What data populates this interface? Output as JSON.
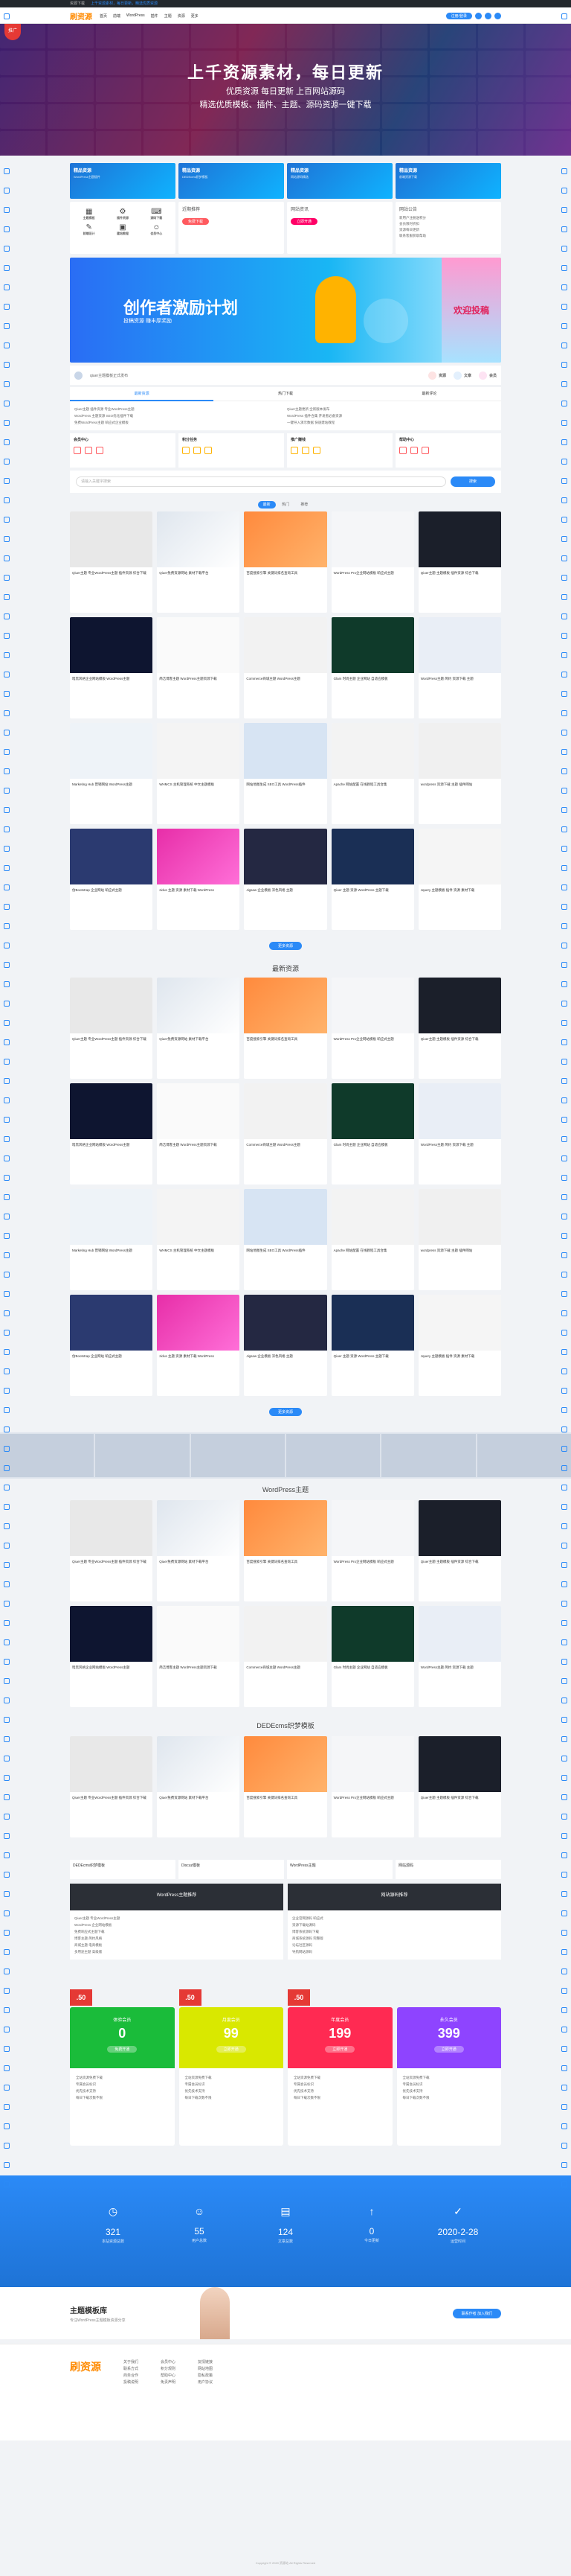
{
  "topbar": {
    "brand": "资源下载",
    "notice": "上千资源素材，每日更新，精选优质资源"
  },
  "header": {
    "logo": "刷资源",
    "nav": [
      "首页",
      "前端",
      "WordPress",
      "插件",
      "主题",
      "资源",
      "更多"
    ],
    "register": "注册/登录"
  },
  "hero": {
    "badge": "推广",
    "title": "上千资源素材，每日更新",
    "line2": "优质资源  每日更新  上百网站源码",
    "line3": "精选优质模板、插件、主题、源码资源一键下载"
  },
  "cards": [
    {
      "title": "精品资源",
      "sub": "WordPress主题插件"
    },
    {
      "title": "精品资源",
      "sub": "DEDEcms织梦模板"
    },
    {
      "title": "精品资源",
      "sub": "网站源码精选"
    },
    {
      "title": "精品资源",
      "sub": "前端资源下载"
    }
  ],
  "services": {
    "icons": [
      "主题模板",
      "插件资源",
      "源码下载",
      "前端设计",
      "建站教程",
      "会员中心"
    ],
    "b2": {
      "head": "近期推荐",
      "btn": "免费下载"
    },
    "b3": {
      "head": "网站资讯",
      "btn": "立即开通"
    },
    "b4": {
      "head": "网站公告",
      "items": [
        "新用户注册送积分",
        "会员限时折扣",
        "资源每日更新",
        "联系客服获取帮助"
      ]
    }
  },
  "banner": {
    "title": "创作者激励计划",
    "sub": "投稿资源  赚丰厚奖励",
    "side": "欢迎投稿"
  },
  "stats": {
    "label": "qiuer主题模板正式发布",
    "items": [
      "资源",
      "文章",
      "会员"
    ]
  },
  "tabs": [
    "最新资源",
    "热门下载",
    "最新评论"
  ],
  "news": {
    "left": [
      "Qiuer主题 插件资源 专业WordPress主题",
      "WordPress 主题资源 SEO优化插件下载",
      "免费WordPress主题 响应式企业模板"
    ],
    "right": [
      "Qiuer主题更新 全新版本发布",
      "WordPress 插件合集 开发者必备资源",
      "一键导入演示数据 快速建站教程"
    ]
  },
  "pub": [
    {
      "head": "会员中心",
      "icons": [
        "资源",
        "下载",
        "收藏"
      ]
    },
    {
      "head": "积分任务",
      "icons": [
        "签到",
        "评论",
        "投稿"
      ]
    },
    {
      "head": "推广赚钱",
      "icons": [
        "推广",
        "提现",
        "明细"
      ]
    },
    {
      "head": "帮助中心",
      "icons": [
        "教程",
        "问答",
        "反馈"
      ]
    }
  ],
  "search": {
    "placeholder": "请输入关键字搜索",
    "btn": "搜索"
  },
  "filter": [
    "最新",
    "热门",
    "推荐"
  ],
  "items": [
    "Qiuer主题 专业WordPress主题 插件资源 综合下载",
    "Qiuer免费资源网站 素材下载平台",
    "百度搜索引擎 关键词排名查询工具",
    "WordPress Pro企业网站模板 响应式主题",
    "Qiuer主题 主题模板 插件资源 综合下载",
    "暗黑风格企业网站模板 WordPress主题",
    "简洁博客主题 WordPress主题资源下载",
    "Commerce商城主题 WordPress主题",
    "Glam 时尚主题 企业网站 自适应模板",
    "WordPress主题 简约 资源下载 主题",
    "Marketing Hub 营销网站 WordPress主题",
    "WHMCS 主机管理系统 中文主题模板",
    "网站地图生成 SEO工具 WordPress插件",
    "Apache 网站配置 在线教程工具合集",
    "wordpress 资源下载 主题 插件网站",
    "仿Bootstrap 企业网站 响应式主题",
    "zidus 主题 资源 素材下载 WordPress",
    "Jigsaw 企业模板 深色风格 主题",
    "Qiuer 主题 资源 WordPress 主题下载",
    "Jquery 主题模板 插件 资源 素材下载"
  ],
  "more": "更多资源",
  "sec1": "最新资源",
  "sec2": "WordPress主题",
  "sec3": "DEDEcms织梦模板",
  "pop": [
    "DEDEcms织梦模板",
    "Discuz模板",
    "WordPress主题",
    "网站源码"
  ],
  "dark": [
    {
      "title": "WordPress主题推荐",
      "items": [
        "Qiuer主题 专业WordPress主题",
        "WordPress 企业网站模板",
        "免费响应式主题下载",
        "博客主题 简约风格",
        "商城主题 电商模板",
        "多用途主题 高级版"
      ]
    },
    {
      "title": "网站源码推荐",
      "items": [
        "企业官网源码 响应式",
        "资源下载站源码",
        "博客系统源码下载",
        "商城系统源码 完整版",
        "论坛社区源码",
        "导航网站源码"
      ]
    }
  ],
  "sale": [
    ".50",
    ".50",
    ".50"
  ],
  "pricing": [
    {
      "name": "体验会员",
      "value": "0",
      "btn": "免费开通",
      "color": "g"
    },
    {
      "name": "月度会员",
      "value": "99",
      "btn": "立即开通",
      "color": "y"
    },
    {
      "name": "年度会员",
      "value": "199",
      "btn": "立即开通",
      "color": "r"
    },
    {
      "name": "永久会员",
      "value": "399",
      "btn": "立即开通",
      "color": "pu"
    }
  ],
  "pricingFeatures": [
    "全站资源免费下载",
    "专属会员标识",
    "优先技术支持",
    "每日下载次数不限"
  ],
  "band": [
    {
      "icon": "◷",
      "value": "321",
      "label": "本站资源总数"
    },
    {
      "icon": "☺",
      "value": "55",
      "label": "用户总数"
    },
    {
      "icon": "▤",
      "value": "124",
      "label": "文章总数"
    },
    {
      "icon": "↑",
      "value": "0",
      "label": "今日更新"
    },
    {
      "icon": "✓",
      "value": "2020-2-28",
      "label": "运营时间"
    }
  ],
  "author": {
    "name": "主题模板库",
    "desc": "专注WordPress主题模板资源分享",
    "cta": "联系作者 加入我们"
  },
  "footer": {
    "logo": "刷资源",
    "cols": [
      [
        "关于我们",
        "联系方式",
        "商务合作",
        "投稿说明"
      ],
      [
        "会员中心",
        "积分规则",
        "帮助中心",
        "免责声明"
      ],
      [
        "友情链接",
        "网站地图",
        "隐私政策",
        "用户协议"
      ]
    ]
  },
  "copyright": "Copyright © 2020 资源站 All Rights Reserved"
}
